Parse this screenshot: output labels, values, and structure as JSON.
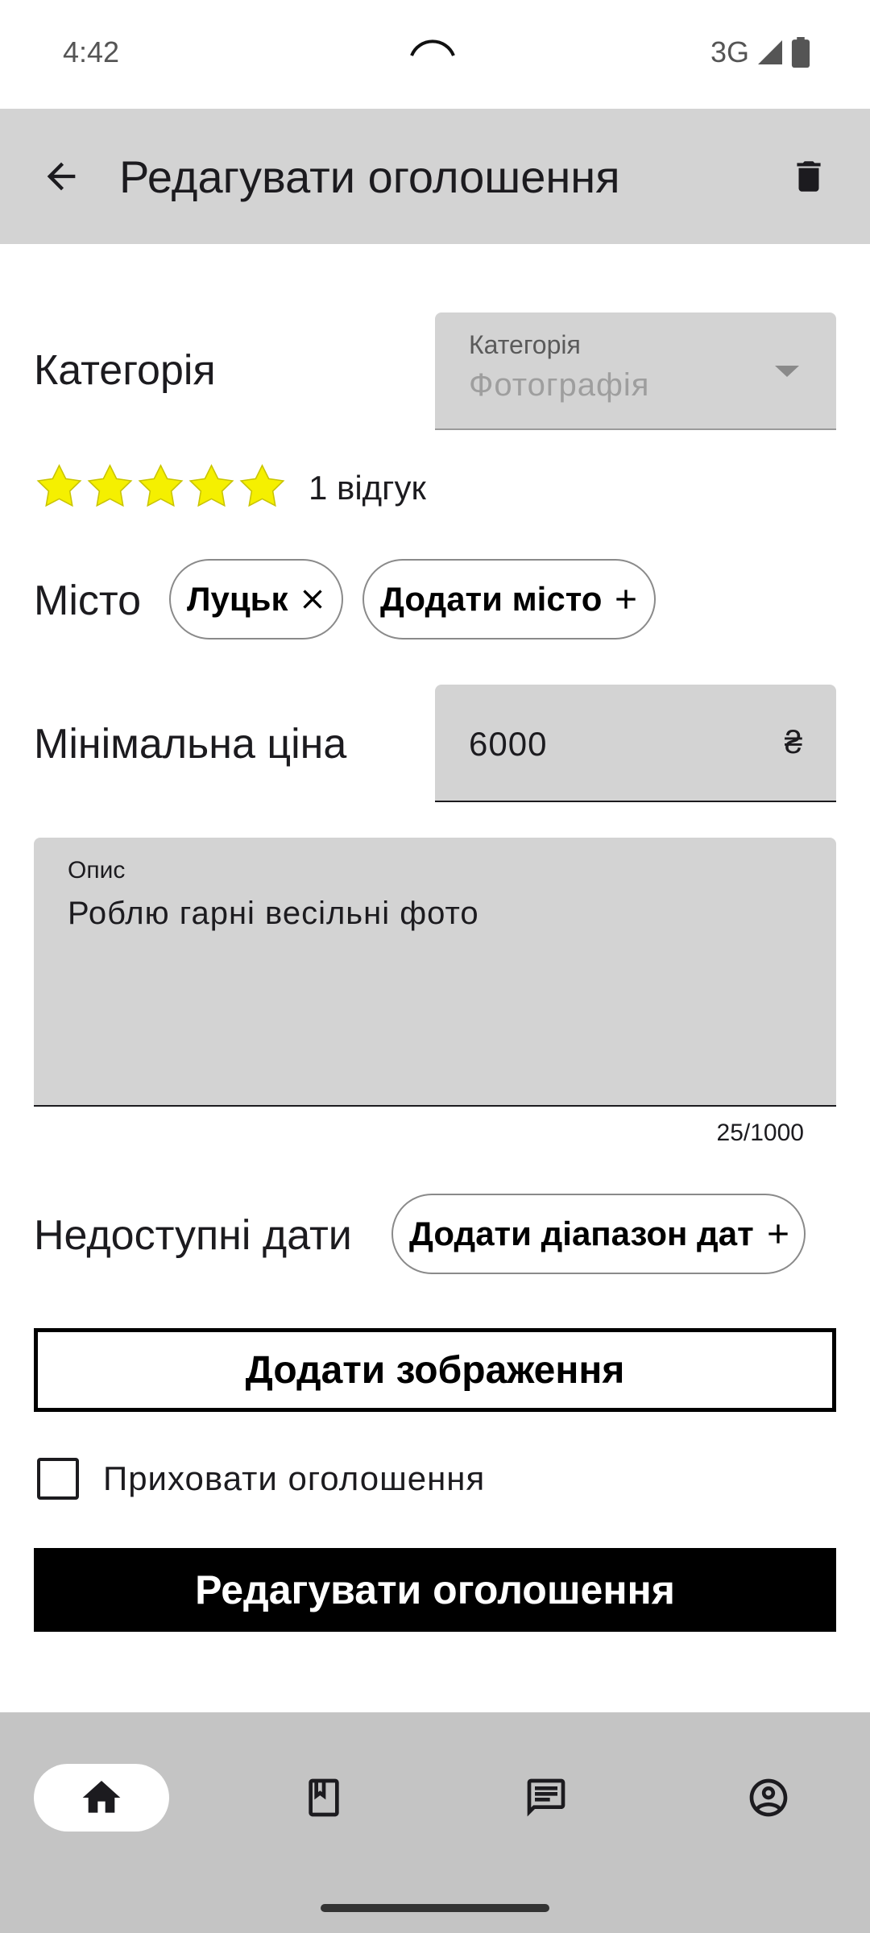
{
  "status_bar": {
    "time": "4:42",
    "network": "3G",
    "icons": [
      "signal-icon",
      "battery-icon"
    ]
  },
  "app_bar": {
    "title": "Редагувати оголошення",
    "back_icon": "arrow-back-icon",
    "delete_icon": "trash-icon"
  },
  "category": {
    "label": "Категорія",
    "field_label": "Категорія",
    "value": "Фотографія"
  },
  "rating": {
    "stars": 5,
    "star_color": "#f5f000",
    "reviews_text": "1 відгук"
  },
  "city": {
    "label": "Місто",
    "chips": [
      "Луцьк"
    ],
    "add_label": "Додати місто"
  },
  "min_price": {
    "label": "Мінімальна ціна",
    "value": "6000",
    "currency": "₴"
  },
  "description": {
    "field_label": "Опис",
    "value": "Роблю гарні весільні фото",
    "counter": "25/1000"
  },
  "unavailable_dates": {
    "label": "Недоступні дати",
    "add_label": "Додати діапазон дат"
  },
  "add_images_label": "Додати зображення",
  "hide_listing": {
    "label": "Приховати оголошення",
    "checked": false
  },
  "submit_label": "Редагувати оголошення",
  "bottom_nav": {
    "items": [
      "home-icon",
      "bookmark-icon",
      "messages-icon",
      "account-icon"
    ],
    "active": "home-icon"
  },
  "colors": {
    "app_bar_bg": "#d3d3d3",
    "field_bg": "#d3d3d3",
    "nav_bg": "#c4c4c4",
    "primary_button": "#000000"
  }
}
